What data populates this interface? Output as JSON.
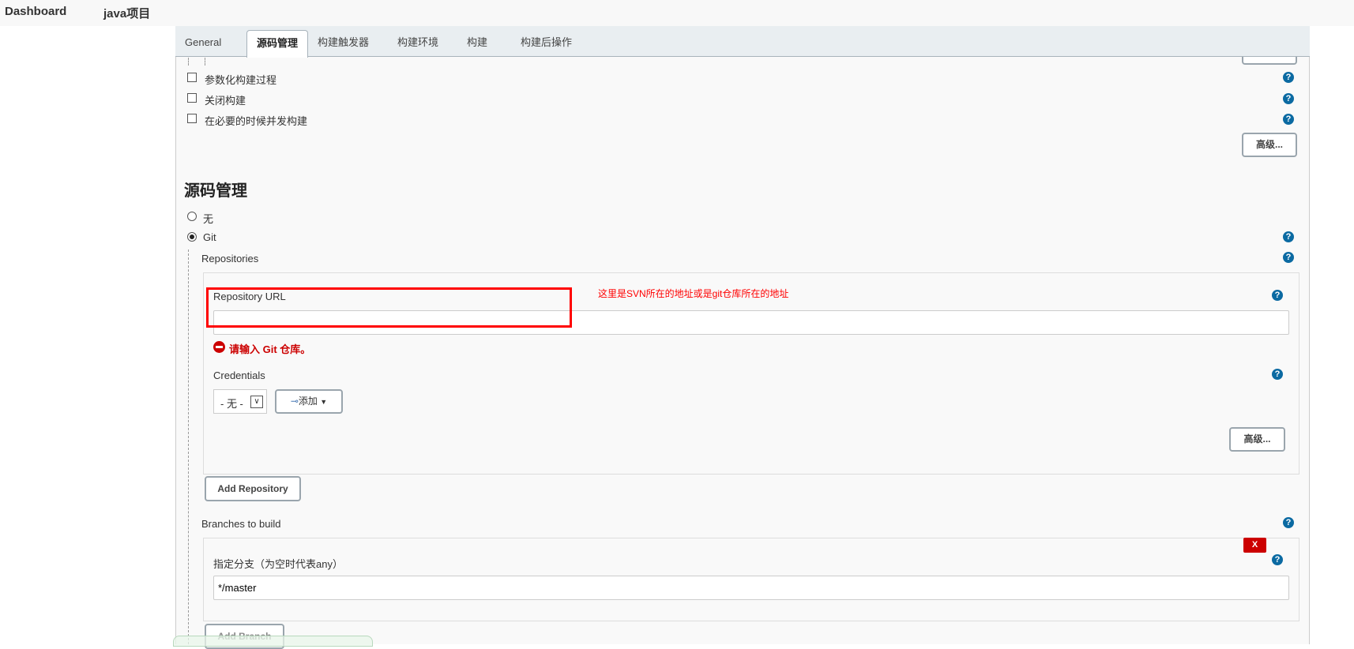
{
  "breadcrumb": [
    "Dashboard",
    "java项目"
  ],
  "tabs": [
    "General",
    "源码管理",
    "构建触发器",
    "构建环境",
    "构建",
    "构建后操作"
  ],
  "options": [
    "参数化构建过程",
    "关闭构建",
    "在必要的时候并发构建"
  ],
  "advanced_label": "高级...",
  "section_title": "源码管理",
  "scm": {
    "none_label": "无",
    "git_label": "Git",
    "selected": "Git"
  },
  "repositories_label": "Repositories",
  "repo": {
    "url_label": "Repository URL",
    "url_value": "",
    "error": "请输入 Git 仓库。",
    "credentials_label": "Credentials",
    "credentials_value": "- 无 -",
    "add_label": "添加",
    "annotation": "这里是SVN所在的地址或是git仓库所在的地址"
  },
  "add_repository_label": "Add Repository",
  "branches_label": "Branches to build",
  "branch": {
    "label": "指定分支（为空时代表any）",
    "value": "*/master",
    "delete_label": "X"
  },
  "add_branch_label": "Add Branch",
  "help_symbol": "?",
  "colors": {
    "help": "#0b6aa2",
    "error": "#cc0000",
    "annotation": "#ff0000"
  }
}
